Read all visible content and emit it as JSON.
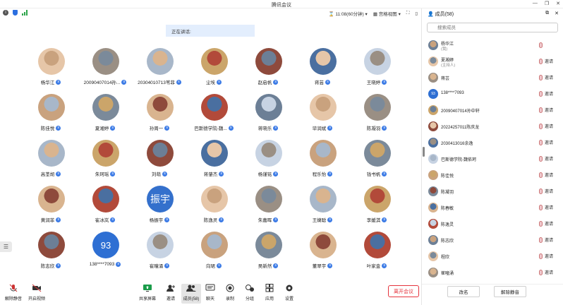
{
  "window": {
    "title": "腾讯会议"
  },
  "topbar": {
    "timer": "11:08(60分钟)",
    "view_label": "宫格视图"
  },
  "speaking": {
    "label": "正在讲话:"
  },
  "panel": {
    "title": "成员(58)",
    "search_placeholder": "搜索成员",
    "rename_label": "改名",
    "unmute_label": "解除静音"
  },
  "participants": [
    [
      "杨华江",
      "20090407014孙...",
      "20304010713苇菲",
      "尘埃",
      "赵启帆",
      "蒋芸",
      "王晓婷"
    ],
    [
      "陈佳悦",
      "夏湘婷",
      "孙周一",
      "巴斯德学院-魏...",
      "蒋晓乐",
      "毕润斌",
      "陈凝羽"
    ],
    [
      "高荃胡",
      "朱珂瑶",
      "刘萌",
      "蒋肇杰",
      "杨谨铭",
      "程乐怡",
      "钱书帆"
    ],
    [
      "黄润菲",
      "崔冰岚",
      "杨振宇",
      "陈逸灵",
      "朱嘉晖",
      "王婕聪",
      "李媛淇"
    ],
    [
      "陈志欣",
      "138****7093",
      "崔曈涌",
      "向珺",
      "吴新然",
      "董翠宇",
      "叶家金"
    ]
  ],
  "grid_digits": {
    "r4c1": "93"
  },
  "grid_word": {
    "r3c2": "振宇"
  },
  "members": [
    {
      "name": "杨华江",
      "sub": "(我)",
      "btn": ""
    },
    {
      "name": "夏湘婷",
      "sub": "(主持人)",
      "btn": "邀请"
    },
    {
      "name": "蒋芸",
      "sub": "",
      "btn": "邀请"
    },
    {
      "name": "138****7093",
      "sub": "",
      "btn": "邀请",
      "digit": "93"
    },
    {
      "name": "20090407014孙中轩",
      "sub": "",
      "btn": "邀请"
    },
    {
      "name": "20224257011陈庆龙",
      "sub": "",
      "btn": "邀请"
    },
    {
      "name": "2030413016余逸",
      "sub": "",
      "btn": "邀请"
    },
    {
      "name": "巴斯德学院-魏依珂",
      "sub": "",
      "btn": "邀请"
    },
    {
      "name": "陈佳悦",
      "sub": "",
      "btn": "邀请"
    },
    {
      "name": "陈凝羽",
      "sub": "",
      "btn": "邀请"
    },
    {
      "name": "陈春敏",
      "sub": "",
      "btn": "邀请"
    },
    {
      "name": "陈逸灵",
      "sub": "",
      "btn": "邀请"
    },
    {
      "name": "陈志欣",
      "sub": "",
      "btn": "邀请"
    },
    {
      "name": "程欣",
      "sub": "",
      "btn": "邀请"
    },
    {
      "name": "崔曈涌",
      "sub": "",
      "btn": "邀请"
    }
  ],
  "bottom": {
    "unmute": "解除静音",
    "video": "开启视频",
    "share": "共享屏幕",
    "invite": "邀请",
    "members": "成员(58)",
    "chat": "聊天",
    "record": "录制",
    "breakout": "分组",
    "apps": "应用",
    "settings": "设置",
    "leave": "离开会议"
  }
}
